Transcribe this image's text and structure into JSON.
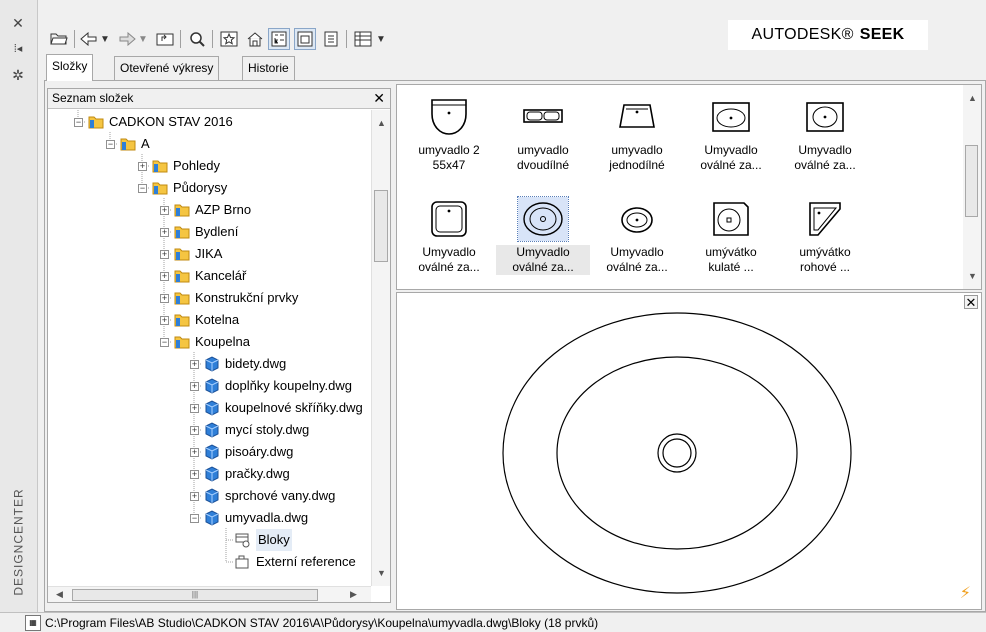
{
  "palette_title": "DESIGNCENTER",
  "logo": {
    "brand": "AUTODESK®",
    "product": "SEEK"
  },
  "tabs": [
    {
      "label": "Složky",
      "active": true
    },
    {
      "label": "Otevřené výkresy",
      "active": false
    },
    {
      "label": "Historie",
      "active": false
    }
  ],
  "tree": {
    "header": "Seznam složek",
    "items": [
      {
        "label": "CADKON STAV 2016",
        "type": "folder",
        "expander": "−"
      },
      {
        "label": "A",
        "type": "folder",
        "expander": "−"
      },
      {
        "label": "Pohledy",
        "type": "folder",
        "expander": "+"
      },
      {
        "label": "Půdorysy",
        "type": "folder",
        "expander": "−"
      },
      {
        "label": "AZP Brno",
        "type": "folder",
        "expander": "+"
      },
      {
        "label": "Bydlení",
        "type": "folder",
        "expander": "+"
      },
      {
        "label": "JIKA",
        "type": "folder",
        "expander": "+"
      },
      {
        "label": "Kancelář",
        "type": "folder",
        "expander": "+"
      },
      {
        "label": "Konstrukční prvky",
        "type": "folder",
        "expander": "+"
      },
      {
        "label": "Kotelna",
        "type": "folder",
        "expander": "+"
      },
      {
        "label": "Koupelna",
        "type": "folder",
        "expander": "−"
      },
      {
        "label": "bidety.dwg",
        "type": "dwg",
        "expander": "+"
      },
      {
        "label": "doplňky koupelny.dwg",
        "type": "dwg",
        "expander": "+"
      },
      {
        "label": "koupelnové skříňky.dwg",
        "type": "dwg",
        "expander": "+"
      },
      {
        "label": "mycí stoly.dwg",
        "type": "dwg",
        "expander": "+"
      },
      {
        "label": "pisoáry.dwg",
        "type": "dwg",
        "expander": "+"
      },
      {
        "label": "pračky.dwg",
        "type": "dwg",
        "expander": "+"
      },
      {
        "label": "sprchové vany.dwg",
        "type": "dwg",
        "expander": "+"
      },
      {
        "label": "umyvadla.dwg",
        "type": "dwg",
        "expander": "−"
      },
      {
        "label": "Bloky",
        "type": "blocks",
        "expander": ""
      },
      {
        "label": "Externí reference",
        "type": "xref",
        "expander": ""
      }
    ]
  },
  "content": {
    "items": [
      {
        "label": "umyvadlo 2\n55x47",
        "icon": "basin-rect-icon"
      },
      {
        "label": "umyvadlo\ndvoudílné",
        "icon": "basin-double-icon"
      },
      {
        "label": "umyvadlo\njednodílné",
        "icon": "basin-single-icon"
      },
      {
        "label": "Umyvadlo\noválné za...",
        "icon": "basin-oval-rect-icon"
      },
      {
        "label": "Umyvadlo\noválné za...",
        "icon": "basin-oval-rect-icon"
      },
      {
        "label": "Umyvadlo\noválné za...",
        "icon": "basin-square-icon"
      },
      {
        "label": "Umyvadlo\noválné za...",
        "icon": "basin-oval-icon",
        "selected": true
      },
      {
        "label": "Umyvadlo\noválné za...",
        "icon": "basin-oval-small-icon"
      },
      {
        "label": "umývátko\nkulaté ...",
        "icon": "basin-round-icon"
      },
      {
        "label": "umývátko\nrohové ...",
        "icon": "basin-corner-icon"
      }
    ]
  },
  "statusbar": {
    "path": "C:\\Program Files\\AB Studio\\CADKON STAV 2016\\A\\Půdorysy\\Koupelna\\umyvadla.dwg\\Bloky (18 prvků)"
  },
  "colors": {
    "folder": "#f5c542",
    "dwg": "#2f7fd8",
    "selection": "#d8e4f8",
    "warning": "#f0a020"
  }
}
